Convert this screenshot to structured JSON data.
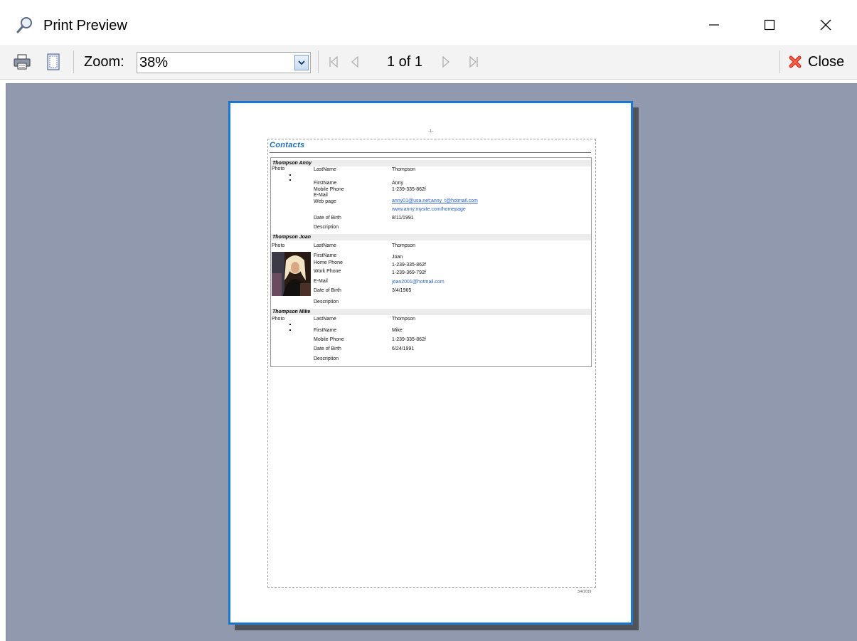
{
  "window": {
    "title": "Print Preview",
    "icon": "magnifier-icon"
  },
  "toolbar": {
    "zoom_label": "Zoom:",
    "zoom_value": "38%",
    "page_indicator": "1 of 1",
    "close_label": "Close"
  },
  "report": {
    "page_number": "-1-",
    "title": "Contacts",
    "footer_date": "3/4/2019",
    "records": [
      {
        "name": "Thompson Anny",
        "photo_label": "Photo",
        "fields": [
          {
            "label": "LastName",
            "value": "Thompson"
          },
          {
            "label": "FirstName",
            "value": "Anny"
          },
          {
            "label": "Mobile Phone",
            "value": "1-239-335-862f"
          },
          {
            "label": "E-Mail",
            "value": "anny01@usa.net;anny_t@hotmail.com"
          },
          {
            "label": "Web page",
            "value": "www.anny.mysite.com/homepage"
          },
          {
            "label": "Date of Birth",
            "value": "8/11/1991"
          },
          {
            "label": "Description",
            "value": ""
          }
        ]
      },
      {
        "name": "Thompson Joan",
        "photo_label": "Photo",
        "fields": [
          {
            "label": "LastName",
            "value": "Thompson"
          },
          {
            "label": "FirstName",
            "value": "Joan"
          },
          {
            "label": "Home Phone",
            "value": "1-239-335-862f"
          },
          {
            "label": "Work Phone",
            "value": "1-239-369-792f"
          },
          {
            "label": "E-Mail",
            "value": "joan2001@hotmail.com"
          },
          {
            "label": "Date of Birth",
            "value": "3/4/1965"
          },
          {
            "label": "Description",
            "value": ""
          }
        ]
      },
      {
        "name": "Thompson Mike",
        "photo_label": "Photo",
        "fields": [
          {
            "label": "LastName",
            "value": "Thompson"
          },
          {
            "label": "FirstName",
            "value": "Mike"
          },
          {
            "label": "Mobile Phone",
            "value": "1-239-335-862f"
          },
          {
            "label": "Date of Birth",
            "value": "6/24/1991"
          },
          {
            "label": "Description",
            "value": ""
          }
        ]
      }
    ]
  },
  "colors": {
    "preview_background": "#9199ae",
    "page_border": "#1a78d2",
    "link": "#2a5fc8",
    "close_icon": "#e0301e"
  }
}
